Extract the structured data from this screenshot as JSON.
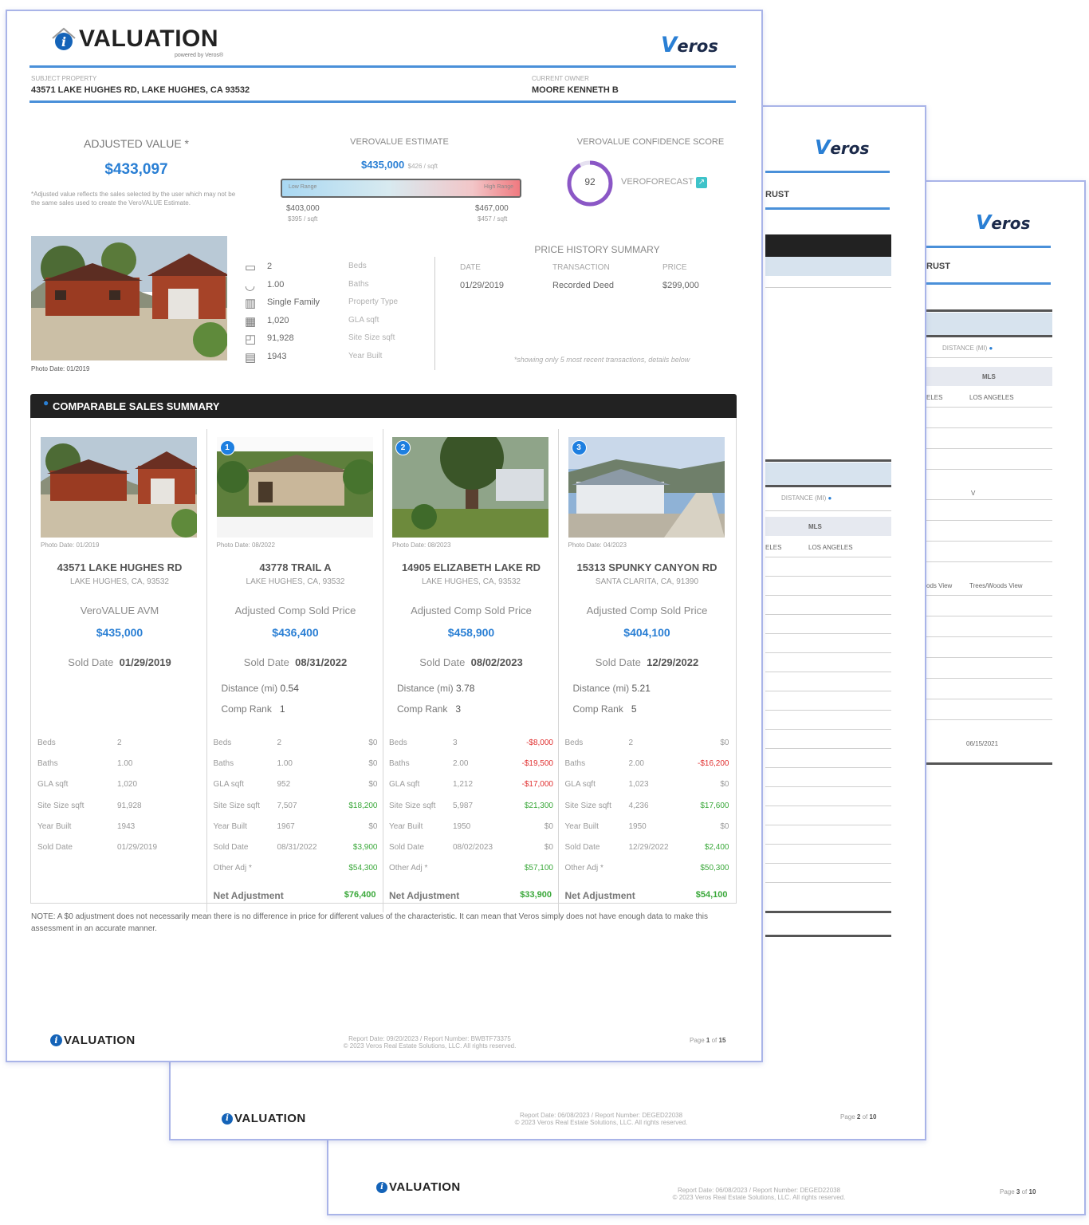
{
  "brand": {
    "valuation_word": "VALUATION",
    "powered_by": "powered by Veros®",
    "veros_word": "eros"
  },
  "page3": {
    "owner_fragment": "RUST",
    "distance_header": "DISTANCE (MI)",
    "mls_header": "MLS",
    "mls_row": [
      "ELES",
      "LOS ANGELES"
    ],
    "v_cell": "V",
    "view_row": [
      "ods View",
      "Trees/Woods View"
    ],
    "date_cell": "06/15/2021",
    "report_line": "Report Date: 06/08/2023 / Report Number: DEGED22038",
    "copyright": "© 2023 Veros Real Estate Solutions, LLC. All rights reserved.",
    "page_label": "Page",
    "page_num": "3",
    "page_of": "of",
    "page_total": "10"
  },
  "page2": {
    "owner_fragment": "RUST",
    "distance_header": "DISTANCE (MI)",
    "mls_header": "MLS",
    "mls_row": [
      "ELES",
      "LOS ANGELES"
    ],
    "report_line": "Report Date: 06/08/2023 / Report Number: DEGED22038",
    "copyright": "© 2023 Veros Real Estate Solutions, LLC. All rights reserved.",
    "page_label": "Page",
    "page_num": "2",
    "page_of": "of",
    "page_total": "10"
  },
  "header": {
    "subject_label": "SUBJECT PROPERTY",
    "subject_address": "43571 LAKE HUGHES RD, LAKE HUGHES, CA 93532",
    "owner_label": "CURRENT OWNER",
    "owner_name": "MOORE KENNETH B"
  },
  "adjusted": {
    "title": "ADJUSTED VALUE *",
    "value": "$433,097",
    "note": "*Adjusted value reflects the sales selected by the user which may not be the same sales used to create the VeroVALUE Estimate."
  },
  "estimate": {
    "title": "VEROVALUE ESTIMATE",
    "value": "$435,000",
    "per_sqft": "$426 / sqft",
    "low_label": "Low Range",
    "high_label": "High Range",
    "low_value": "$403,000",
    "low_sqft": "$395 / sqft",
    "high_value": "$467,000",
    "high_sqft": "$457 / sqft"
  },
  "confidence": {
    "title": "VEROVALUE CONFIDENCE SCORE",
    "score": "92",
    "score_fraction": 0.92,
    "forecast_label": "VEROFORECAST"
  },
  "subject_photo_date": "Photo Date: 01/2019",
  "property": [
    {
      "icon": "bed-icon",
      "value": "2",
      "label": "Beds"
    },
    {
      "icon": "bath-icon",
      "value": "1.00",
      "label": "Baths"
    },
    {
      "icon": "building-icon",
      "value": "Single Family",
      "label": "Property Type"
    },
    {
      "icon": "floorplan-icon",
      "value": "1,020",
      "label": "GLA sqft"
    },
    {
      "icon": "lot-icon",
      "value": "91,928",
      "label": "Site Size sqft"
    },
    {
      "icon": "calendar-icon",
      "value": "1943",
      "label": "Year Built"
    }
  ],
  "price_history": {
    "title": "PRICE HISTORY SUMMARY",
    "headers": [
      "DATE",
      "TRANSACTION",
      "PRICE"
    ],
    "rows": [
      [
        "01/29/2019",
        "Recorded Deed",
        "$299,000"
      ]
    ],
    "note": "*showing only 5 most recent transactions, details below"
  },
  "comps_section": {
    "title": "COMPARABLE SALES SUMMARY",
    "sold_label": "Sold Date",
    "distance_label": "Distance (mi)",
    "rank_label": "Comp Rank",
    "net_label": "Net Adjustment",
    "footnote": "NOTE: A $0 adjustment does not necessarily mean there is no difference in price for different values of the characteristic. It can mean that Veros simply does not have enough data to make this assessment in an accurate manner."
  },
  "comps": [
    {
      "badge": "",
      "photo_date": "Photo Date: 01/2019",
      "address": "43571 LAKE HUGHES RD",
      "city": "LAKE HUGHES, CA, 93532",
      "price_label": "VeroVALUE AVM",
      "price": "$435,000",
      "sold_date": "01/29/2019",
      "distance": "",
      "rank": "",
      "rows": [
        [
          "Beds",
          "2",
          ""
        ],
        [
          "Baths",
          "1.00",
          ""
        ],
        [
          "GLA sqft",
          "1,020",
          ""
        ],
        [
          "Site Size sqft",
          "91,928",
          ""
        ],
        [
          "Year Built",
          "1943",
          ""
        ],
        [
          "Sold Date",
          "01/29/2019",
          ""
        ]
      ],
      "net": ""
    },
    {
      "badge": "1",
      "photo_date": "Photo Date: 08/2022",
      "address": "43778 TRAIL A",
      "city": "LAKE HUGHES, CA, 93532",
      "price_label": "Adjusted Comp Sold Price",
      "price": "$436,400",
      "sold_date": "08/31/2022",
      "distance": "0.54",
      "rank": "1",
      "rows": [
        [
          "Beds",
          "2",
          "$0"
        ],
        [
          "Baths",
          "1.00",
          "$0"
        ],
        [
          "GLA sqft",
          "952",
          "$0"
        ],
        [
          "Site Size sqft",
          "7,507",
          "$18,200"
        ],
        [
          "Year Built",
          "1967",
          "$0"
        ],
        [
          "Sold Date",
          "08/31/2022",
          "$3,900"
        ],
        [
          "Other Adj *",
          "",
          "$54,300"
        ]
      ],
      "net": "$76,400"
    },
    {
      "badge": "2",
      "photo_date": "Photo Date: 08/2023",
      "address": "14905 ELIZABETH LAKE RD",
      "city": "LAKE HUGHES, CA, 93532",
      "price_label": "Adjusted Comp Sold Price",
      "price": "$458,900",
      "sold_date": "08/02/2023",
      "distance": "3.78",
      "rank": "3",
      "rows": [
        [
          "Beds",
          "3",
          "-$8,000"
        ],
        [
          "Baths",
          "2.00",
          "-$19,500"
        ],
        [
          "GLA sqft",
          "1,212",
          "-$17,000"
        ],
        [
          "Site Size sqft",
          "5,987",
          "$21,300"
        ],
        [
          "Year Built",
          "1950",
          "$0"
        ],
        [
          "Sold Date",
          "08/02/2023",
          "$0"
        ],
        [
          "Other Adj *",
          "",
          "$57,100"
        ]
      ],
      "net": "$33,900"
    },
    {
      "badge": "3",
      "photo_date": "Photo Date: 04/2023",
      "address": "15313 SPUNKY CANYON RD",
      "city": "SANTA CLARITA, CA, 91390",
      "price_label": "Adjusted Comp Sold Price",
      "price": "$404,100",
      "sold_date": "12/29/2022",
      "distance": "5.21",
      "rank": "5",
      "rows": [
        [
          "Beds",
          "2",
          "$0"
        ],
        [
          "Baths",
          "2.00",
          "-$16,200"
        ],
        [
          "GLA sqft",
          "1,023",
          "$0"
        ],
        [
          "Site Size sqft",
          "4,236",
          "$17,600"
        ],
        [
          "Year Built",
          "1950",
          "$0"
        ],
        [
          "Sold Date",
          "12/29/2022",
          "$2,400"
        ],
        [
          "Other Adj *",
          "",
          "$50,300"
        ]
      ],
      "net": "$54,100"
    }
  ],
  "footer": {
    "report_line": "Report Date: 09/20/2023 / Report Number: BWBTF73375",
    "copyright": "© 2023 Veros Real Estate Solutions, LLC. All rights reserved.",
    "page_label": "Page",
    "page_num": "1",
    "page_of": "of",
    "page_total": "15"
  }
}
